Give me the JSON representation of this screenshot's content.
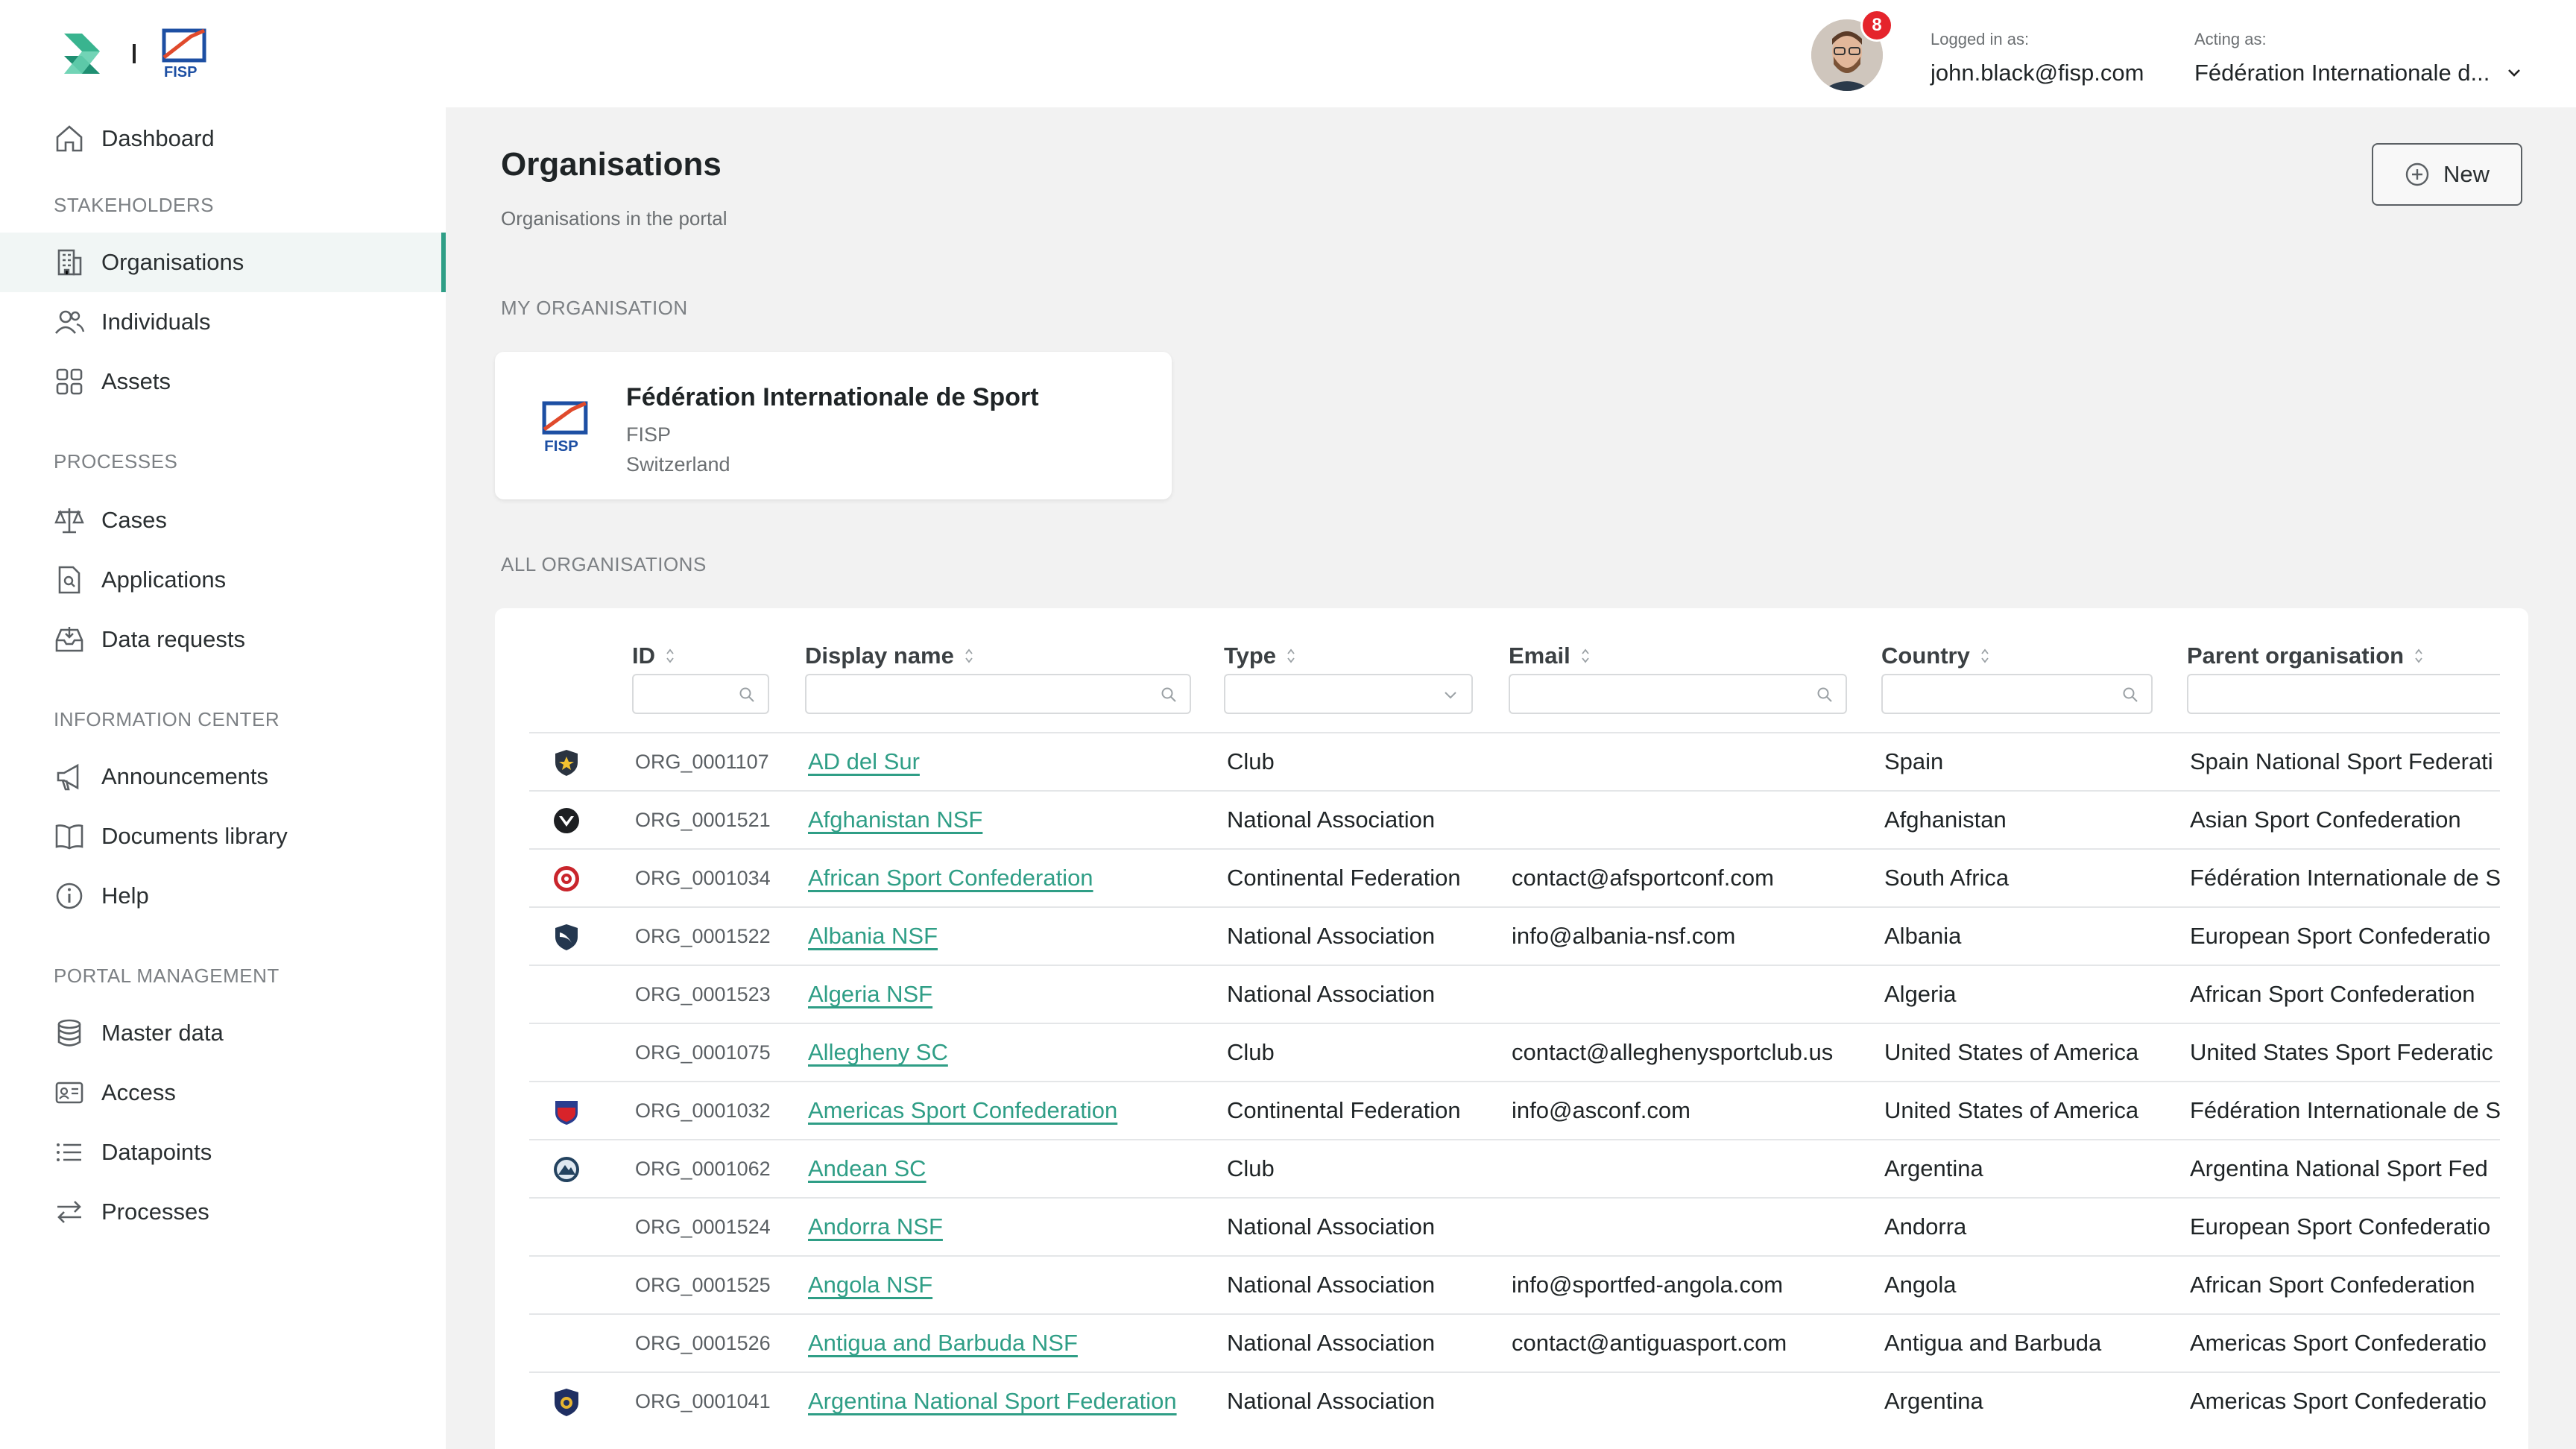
{
  "header": {
    "notifications": "8",
    "logged_in_label": "Logged in as:",
    "logged_in_value": "john.black@fisp.com",
    "acting_label": "Acting as:",
    "acting_value": "Fédération Internationale d..."
  },
  "brand": {
    "fisp_text": "FISP"
  },
  "sidebar": {
    "dashboard": "Dashboard",
    "sections": {
      "stakeholders": "STAKEHOLDERS",
      "processes": "PROCESSES",
      "information_center": "INFORMATION CENTER",
      "portal_management": "PORTAL MANAGEMENT"
    },
    "items": {
      "organisations": "Organisations",
      "individuals": "Individuals",
      "assets": "Assets",
      "cases": "Cases",
      "applications": "Applications",
      "data_requests": "Data requests",
      "announcements": "Announcements",
      "documents_library": "Documents library",
      "help": "Help",
      "master_data": "Master data",
      "access": "Access",
      "datapoints": "Datapoints",
      "processes": "Processes"
    }
  },
  "main": {
    "title": "Organisations",
    "subtitle": "Organisations in the portal",
    "new_button": "New",
    "my_org_label": "MY ORGANISATION",
    "all_orgs_label": "ALL ORGANISATIONS"
  },
  "my_org": {
    "name": "Fédération Internationale de Sport",
    "abbr": "FISP",
    "country": "Switzerland"
  },
  "table": {
    "columns": {
      "id": "ID",
      "display_name": "Display name",
      "type": "Type",
      "email": "Email",
      "country": "Country",
      "parent": "Parent organisation"
    },
    "rows": [
      {
        "icon": "shield-star-icon",
        "id": "ORG_0001107",
        "name": "AD del Sur",
        "type": "Club",
        "email": "",
        "country": "Spain",
        "parent": "Spain National Sport Federati"
      },
      {
        "icon": "shield-chevron-icon",
        "id": "ORG_0001521",
        "name": "Afghanistan NSF",
        "type": "National Association",
        "email": "",
        "country": "Afghanistan",
        "parent": "Asian Sport Confederation"
      },
      {
        "icon": "target-icon",
        "id": "ORG_0001034",
        "name": "African Sport Confederation",
        "type": "Continental Federation",
        "email": "contact@afsportconf.com",
        "country": "South Africa",
        "parent": "Fédération Internationale de S"
      },
      {
        "icon": "shield-wing-icon",
        "id": "ORG_0001522",
        "name": "Albania NSF",
        "type": "National Association",
        "email": "info@albania-nsf.com",
        "country": "Albania",
        "parent": "European Sport Confederatio"
      },
      {
        "icon": "",
        "id": "ORG_0001523",
        "name": "Algeria NSF",
        "type": "National Association",
        "email": "",
        "country": "Algeria",
        "parent": "African Sport Confederation"
      },
      {
        "icon": "",
        "id": "ORG_0001075",
        "name": "Allegheny SC",
        "type": "Club",
        "email": "contact@alleghenysportclub.us",
        "country": "United States of America",
        "parent": "United States Sport Federatic"
      },
      {
        "icon": "shield-red-icon",
        "id": "ORG_0001032",
        "name": "Americas Sport Confederation",
        "type": "Continental Federation",
        "email": "info@asconf.com",
        "country": "United States of America",
        "parent": "Fédération Internationale de S"
      },
      {
        "icon": "mountain-badge-icon",
        "id": "ORG_0001062",
        "name": "Andean SC",
        "type": "Club",
        "email": "",
        "country": "Argentina",
        "parent": "Argentina National Sport Fed"
      },
      {
        "icon": "",
        "id": "ORG_0001524",
        "name": "Andorra NSF",
        "type": "National Association",
        "email": "",
        "country": "Andorra",
        "parent": "European Sport Confederatio"
      },
      {
        "icon": "",
        "id": "ORG_0001525",
        "name": "Angola NSF",
        "type": "National Association",
        "email": "info@sportfed-angola.com",
        "country": "Angola",
        "parent": "African Sport Confederation"
      },
      {
        "icon": "",
        "id": "ORG_0001526",
        "name": "Antigua and Barbuda NSF",
        "type": "National Association",
        "email": "contact@antiguasport.com",
        "country": "Antigua and Barbuda",
        "parent": "Americas Sport Confederatio"
      },
      {
        "icon": "shield-gold-icon",
        "id": "ORG_0001041",
        "name": "Argentina National Sport Federation",
        "type": "National Association",
        "email": "",
        "country": "Argentina",
        "parent": "Americas Sport Confederatio"
      }
    ]
  },
  "colors": {
    "accent": "#2f9e86",
    "badge": "#e5242c",
    "fisp_blue": "#1d4fa3",
    "fisp_red": "#e04a2c"
  }
}
